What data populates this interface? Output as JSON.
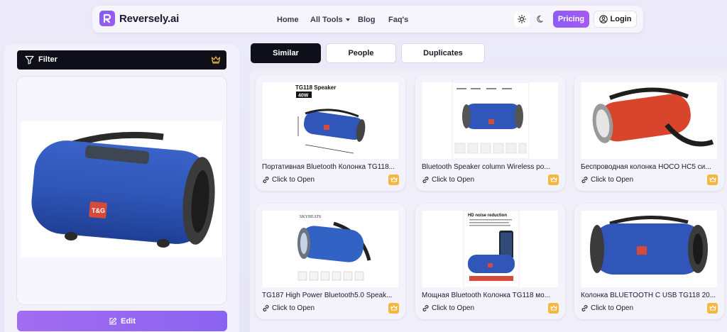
{
  "brand": {
    "name": "Reversely.ai",
    "accent": "#8b5cf6"
  },
  "nav": {
    "links": [
      "Home",
      "All Tools",
      "Blog",
      "Faq's"
    ],
    "pricing_label": "Pricing",
    "login_label": "Login"
  },
  "sidebar": {
    "filter_label": "Filter",
    "edit_label": "Edit"
  },
  "tabs": [
    {
      "label": "Similar",
      "active": true
    },
    {
      "label": "People",
      "active": false
    },
    {
      "label": "Duplicates",
      "active": false
    }
  ],
  "results": [
    {
      "title": "Портативная Bluetooth Колонка TG118...",
      "open_label": "Click to Open",
      "image_text": "TG118 Speaker",
      "image_badge": "40W"
    },
    {
      "title": "Bluetooth Speaker column Wireless po...",
      "open_label": "Click to Open"
    },
    {
      "title": "Беспроводная колонка HOCO HC5 си...",
      "open_label": "Click to Open"
    },
    {
      "title": "TG187 High Power Bluetooth5.0 Speak...",
      "open_label": "Click to Open",
      "image_text": "SKYBEATS"
    },
    {
      "title": "Мощная Bluetooth Колонка TG118 мо...",
      "open_label": "Click to Open",
      "image_text": "HD noise reduction"
    },
    {
      "title": "Колонка BLUETOOTH С USB TG118 20...",
      "open_label": "Click to Open"
    }
  ],
  "product_logo_text": "T&G"
}
